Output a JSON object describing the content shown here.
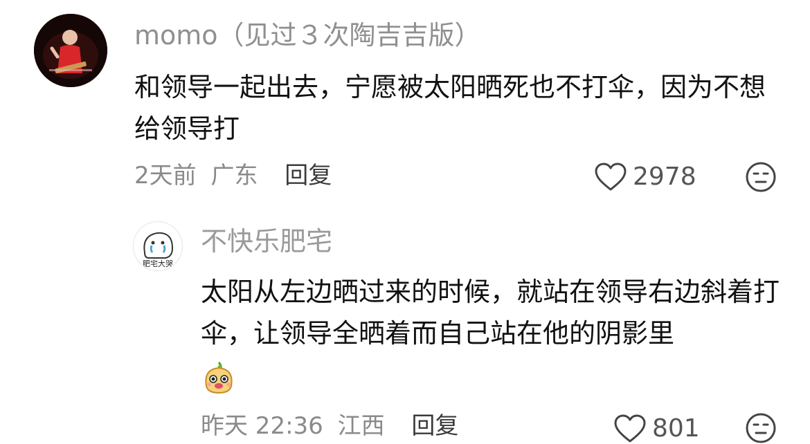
{
  "comment": {
    "username": "momo（见过３次陶吉吉版）",
    "text": "和领导一起出去，宁愿被太阳晒死也不打伞，因为不想给领导打",
    "time": "2天前",
    "location": "广东",
    "reply_label": "回复",
    "like_count": "2978",
    "avatar_icon": "user-avatar-icon",
    "like_icon": "heart-outline-icon",
    "emoji_icon": "neutral-face-icon"
  },
  "reply": {
    "username": "不快乐肥宅",
    "avatar_caption": "肥宅大哭",
    "text": "太阳从左边晒过来的时候，就站在领导右边斜着打伞，让领导全晒着而自己站在他的阴影里",
    "sticker_icon": "cute-blob-sticker-icon",
    "time": "昨天 22:36",
    "location": "江西",
    "reply_label": "回复",
    "like_count": "801",
    "like_icon": "heart-outline-icon",
    "emoji_icon": "neutral-face-icon"
  },
  "colors": {
    "text_primary": "#111111",
    "text_secondary": "#8f8f8f",
    "icon_stroke": "#444444"
  }
}
